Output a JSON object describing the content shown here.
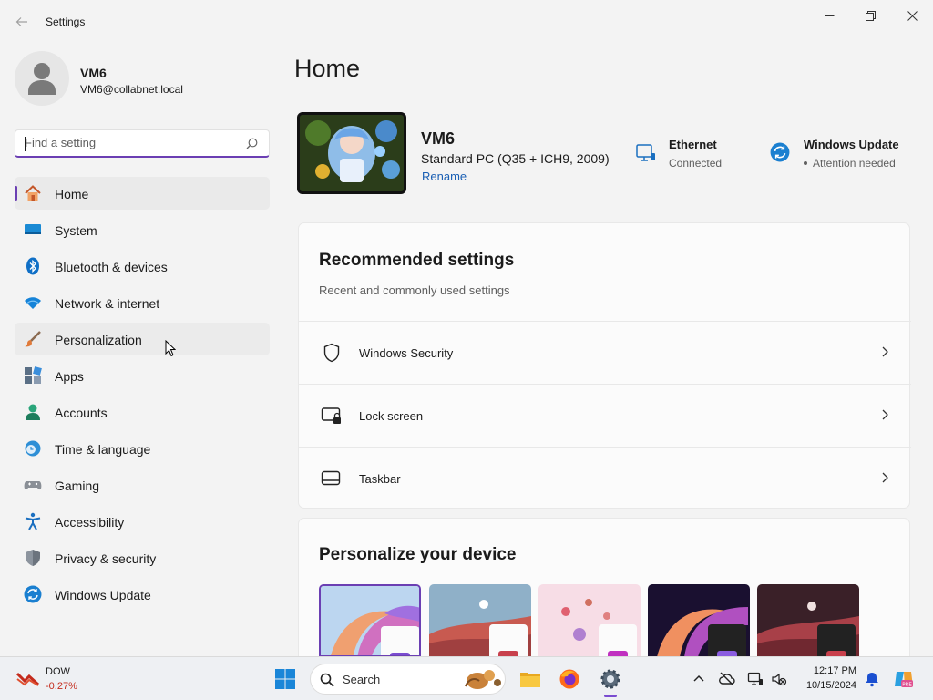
{
  "window": {
    "title": "Settings"
  },
  "profile": {
    "name": "VM6",
    "email": "VM6@collabnet.local"
  },
  "search": {
    "placeholder": "Find a setting"
  },
  "nav": {
    "items": [
      {
        "label": "Home",
        "icon": "home-icon"
      },
      {
        "label": "System",
        "icon": "system-icon"
      },
      {
        "label": "Bluetooth & devices",
        "icon": "bluetooth-icon"
      },
      {
        "label": "Network & internet",
        "icon": "wifi-icon"
      },
      {
        "label": "Personalization",
        "icon": "paintbrush-icon"
      },
      {
        "label": "Apps",
        "icon": "apps-icon"
      },
      {
        "label": "Accounts",
        "icon": "accounts-icon"
      },
      {
        "label": "Time & language",
        "icon": "clock-globe-icon"
      },
      {
        "label": "Gaming",
        "icon": "gamepad-icon"
      },
      {
        "label": "Accessibility",
        "icon": "accessibility-icon"
      },
      {
        "label": "Privacy & security",
        "icon": "shield-icon"
      },
      {
        "label": "Windows Update",
        "icon": "update-icon"
      }
    ]
  },
  "main": {
    "title": "Home",
    "device": {
      "name": "VM6",
      "model": "Standard PC (Q35 + ICH9, 2009)",
      "rename": "Rename"
    },
    "status": [
      {
        "title": "Ethernet",
        "subtitle": "Connected",
        "icon": "ethernet-icon"
      },
      {
        "title": "Windows Update",
        "subtitle": "Attention needed",
        "icon": "update-icon"
      }
    ],
    "recommended": {
      "title": "Recommended settings",
      "subtitle": "Recent and commonly used settings",
      "items": [
        {
          "label": "Windows Security",
          "icon": "shield-outline-icon"
        },
        {
          "label": "Lock screen",
          "icon": "lock-screen-icon"
        },
        {
          "label": "Taskbar",
          "icon": "taskbar-icon"
        }
      ]
    },
    "personalize": {
      "title": "Personalize your device"
    }
  },
  "taskbar": {
    "widget": {
      "name": "DOW",
      "change": "-0.27%"
    },
    "search_label": "Search",
    "clock": {
      "time": "12:17 PM",
      "date": "10/15/2024"
    }
  },
  "colors": {
    "accent": "#6b3fb3",
    "link": "#1a5fb4",
    "negative": "#c42b1c"
  }
}
